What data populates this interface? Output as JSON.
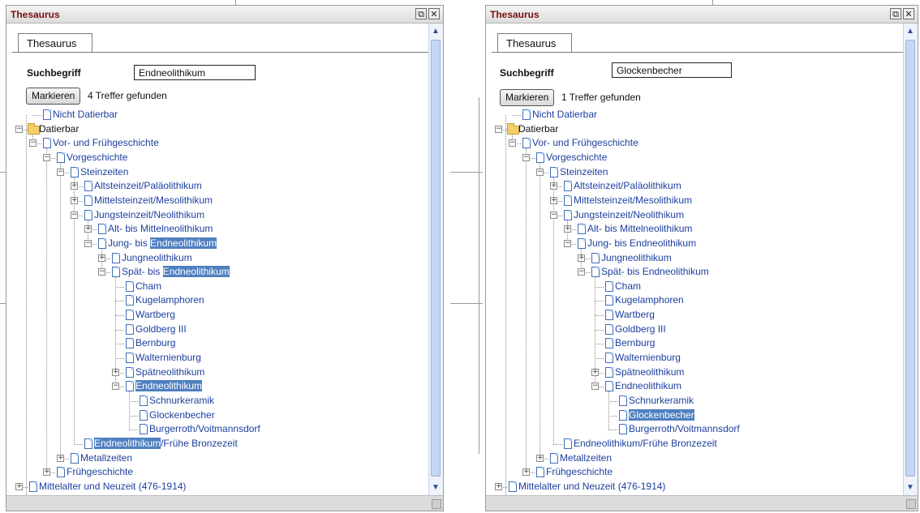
{
  "windows": [
    {
      "title": "Thesaurus",
      "tab_label": "Thesaurus",
      "search_label": "Suchbegriff",
      "search_value": "Endneolithikum",
      "mark_button_label": "Markieren",
      "status_text": "4 Treffer gefunden"
    },
    {
      "title": "Thesaurus",
      "tab_label": "Thesaurus",
      "search_label": "Suchbegriff",
      "search_value": "Glockenbecher",
      "mark_button_label": "Markieren",
      "status_text": "1 Treffer gefunden"
    }
  ],
  "tree_left": [
    {
      "text": "Nicht Datierbar"
    },
    {
      "text": "Datierbar",
      "icon": "folder",
      "toggle": "minus"
    },
    {
      "text": "Vor- und Frühgeschichte",
      "toggle": "minus"
    },
    {
      "text": "Vorgeschichte",
      "toggle": "minus"
    },
    {
      "text": "Steinzeiten",
      "toggle": "minus"
    },
    {
      "text": "Altsteinzeit/Paläolithikum",
      "toggle": "plus"
    },
    {
      "text": "Mittelsteinzeit/Mesolithikum",
      "toggle": "plus"
    },
    {
      "text": "Jungsteinzeit/Neolithikum",
      "toggle": "minus"
    },
    {
      "text": "Alt- bis Mittelneolithikum",
      "toggle": "plus"
    },
    {
      "text": "Jung- bis ",
      "highlight": "Endneolithikum",
      "toggle": "minus"
    },
    {
      "text": "Jungneolithikum",
      "toggle": "plus"
    },
    {
      "text": "Spät- bis ",
      "highlight": "Endneolithikum",
      "toggle": "minus"
    },
    {
      "text": "Cham"
    },
    {
      "text": "Kugelamphoren"
    },
    {
      "text": "Wartberg"
    },
    {
      "text": "Goldberg III"
    },
    {
      "text": "Bernburg"
    },
    {
      "text": "Walternienburg"
    },
    {
      "text": "Spätneolithikum",
      "toggle": "plus"
    },
    {
      "text": "",
      "highlight": "Endneolithikum",
      "toggle": "minus"
    },
    {
      "text": "Schnurkeramik"
    },
    {
      "text": "Glockenbecher"
    },
    {
      "text": "Burgerroth/Voitmannsdorf"
    },
    {
      "text": "",
      "highlight": "Endneolithikum",
      "tail": "/Frühe Bronzezeit"
    },
    {
      "text": "Metallzeiten",
      "toggle": "plus"
    },
    {
      "text": "Frühgeschichte",
      "toggle": "plus"
    },
    {
      "text": "Mittelalter und Neuzeit (476-1914)",
      "toggle": "plus"
    }
  ],
  "tree_right": [
    {
      "text": "Nicht Datierbar"
    },
    {
      "text": "Datierbar",
      "icon": "folder",
      "toggle": "minus"
    },
    {
      "text": "Vor- und Frühgeschichte",
      "toggle": "minus"
    },
    {
      "text": "Vorgeschichte",
      "toggle": "minus"
    },
    {
      "text": "Steinzeiten",
      "toggle": "minus"
    },
    {
      "text": "Altsteinzeit/Paläolithikum",
      "toggle": "plus"
    },
    {
      "text": "Mittelsteinzeit/Mesolithikum",
      "toggle": "plus"
    },
    {
      "text": "Jungsteinzeit/Neolithikum",
      "toggle": "minus"
    },
    {
      "text": "Alt- bis Mittelneolithikum",
      "toggle": "plus"
    },
    {
      "text": "Jung- bis Endneolithikum",
      "toggle": "minus"
    },
    {
      "text": "Jungneolithikum",
      "toggle": "plus"
    },
    {
      "text": "Spät- bis Endneolithikum",
      "toggle": "minus"
    },
    {
      "text": "Cham"
    },
    {
      "text": "Kugelamphoren"
    },
    {
      "text": "Wartberg"
    },
    {
      "text": "Goldberg III"
    },
    {
      "text": "Bernburg"
    },
    {
      "text": "Walternienburg"
    },
    {
      "text": "Spätneolithikum",
      "toggle": "plus"
    },
    {
      "text": "Endneolithikum",
      "toggle": "minus"
    },
    {
      "text": "Schnurkeramik"
    },
    {
      "text": "",
      "highlight": "Glockenbecher"
    },
    {
      "text": "Burgerroth/Voitmannsdorf"
    },
    {
      "text": "Endneolithikum/Frühe Bronzezeit"
    },
    {
      "text": "Metallzeiten",
      "toggle": "plus"
    },
    {
      "text": "Frühgeschichte",
      "toggle": "plus"
    },
    {
      "text": "Mittelalter und Neuzeit (476-1914)",
      "toggle": "plus"
    }
  ],
  "icons": {
    "restore": "restore-icon",
    "close": "close-icon",
    "scroll_up": "arrow-up-icon",
    "scroll_down": "arrow-down-icon",
    "tree_expanded": "minus-box-icon",
    "tree_collapsed": "plus-box-icon",
    "tree_document": "document-icon",
    "tree_folder": "open-folder-icon"
  },
  "colors": {
    "title_text": "#7a0f0f",
    "tree_link": "#1d3f9e",
    "highlight_bg": "#4f7fc0",
    "highlight_text": "#ffffff"
  }
}
